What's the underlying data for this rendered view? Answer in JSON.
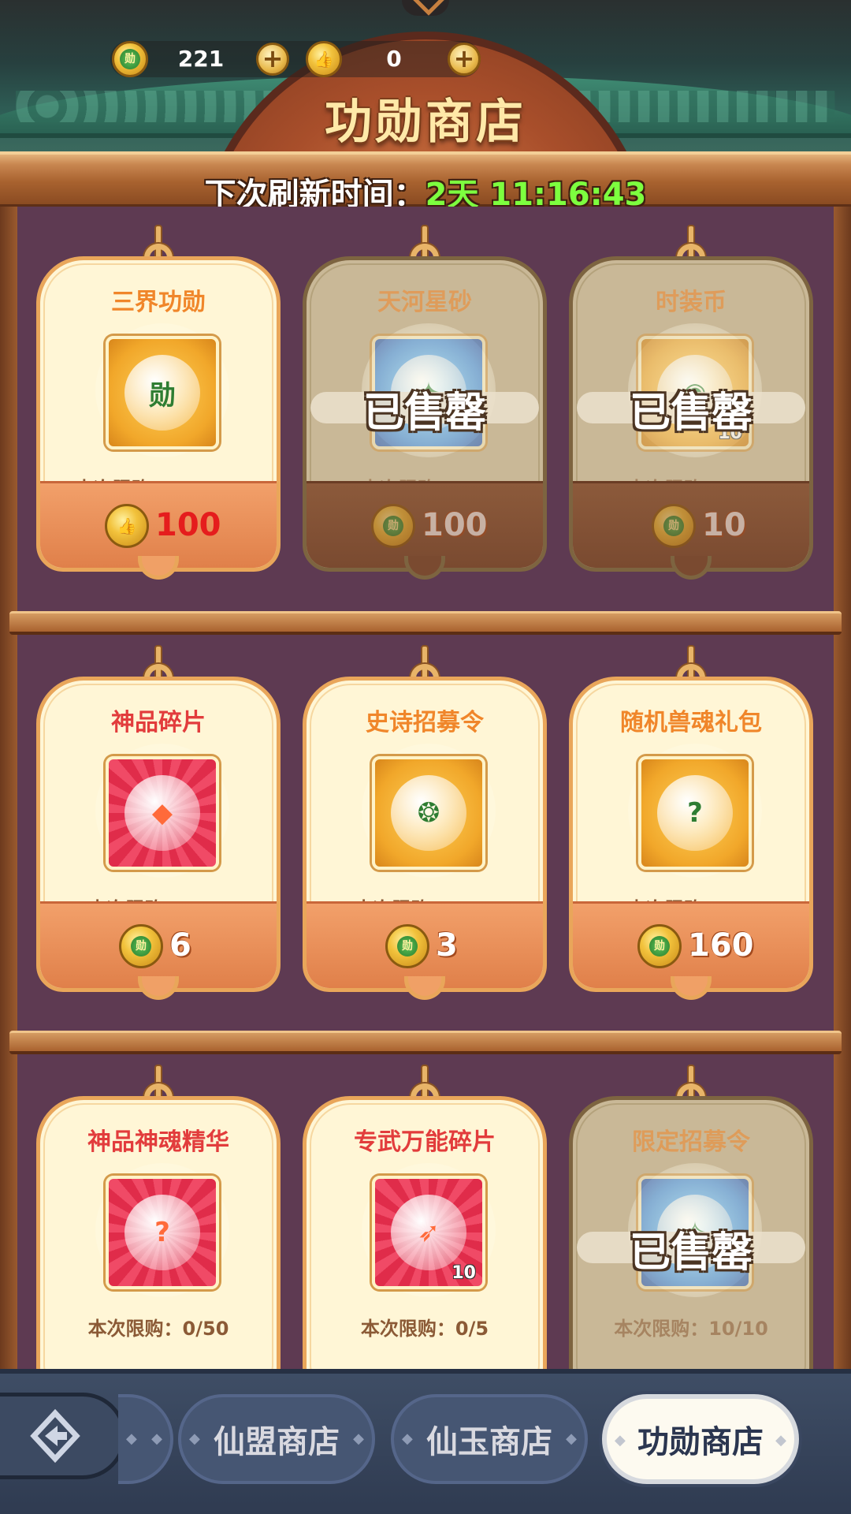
{
  "header": {
    "title": "功勋商店",
    "currency_merit": {
      "value": "221",
      "icon": "merit-coin-icon"
    },
    "currency_thumb": {
      "value": "0",
      "icon": "thumb-coin-icon"
    },
    "plus_symbol": "+"
  },
  "refresh": {
    "label": "下次刷新时间：",
    "time": "2天 11:16:43"
  },
  "sold_out_label": "已售罄",
  "items": [
    {
      "name": "三界功勋",
      "limit": "本次限购：84/200",
      "price": "100",
      "currency": "thumb",
      "sold": false,
      "quality": "gold",
      "qty": ""
    },
    {
      "name": "天河星砂",
      "limit": "本次限购：2/2",
      "price": "100",
      "currency": "merit",
      "sold": true,
      "quality": "blue",
      "qty": ""
    },
    {
      "name": "时装币",
      "limit": "本次限购：5/5",
      "price": "10",
      "currency": "merit",
      "sold": true,
      "quality": "gold",
      "qty": "10"
    },
    {
      "name": "神品碎片",
      "limit": "本次限购：0/30",
      "price": "6",
      "currency": "merit",
      "sold": false,
      "quality": "red",
      "qty": ""
    },
    {
      "name": "史诗招募令",
      "limit": "本次限购：0/30",
      "price": "3",
      "currency": "merit",
      "sold": false,
      "quality": "gold",
      "qty": ""
    },
    {
      "name": "随机兽魂礼包",
      "limit": "本次限购：0/3",
      "price": "160",
      "currency": "merit",
      "sold": false,
      "quality": "gold",
      "qty": ""
    },
    {
      "name": "神品神魂精华",
      "limit": "本次限购：0/50",
      "price": "",
      "currency": "merit",
      "sold": false,
      "quality": "red",
      "qty": ""
    },
    {
      "name": "专武万能碎片",
      "limit": "本次限购：0/5",
      "price": "",
      "currency": "merit",
      "sold": false,
      "quality": "red",
      "qty": "10"
    },
    {
      "name": "限定招募令",
      "limit": "本次限购：10/10",
      "price": "",
      "currency": "merit",
      "sold": true,
      "quality": "blue",
      "qty": ""
    }
  ],
  "tabs": [
    {
      "label": "仙盟商店",
      "active": false
    },
    {
      "label": "仙玉商店",
      "active": false
    },
    {
      "label": "功勋商店",
      "active": true
    }
  ],
  "colors": {
    "accent_green": "#7dff3f",
    "price_red": "#e51d1d",
    "card_cream": "#fff6d6",
    "shelf": "#5e3a52"
  }
}
